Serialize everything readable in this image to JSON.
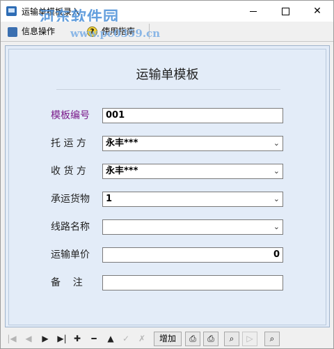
{
  "window": {
    "title": "运输单模板录入",
    "watermark_logo": "河东软件园",
    "watermark_url": "www.pc0359.cn"
  },
  "menubar": {
    "items": [
      {
        "label": "信息操作",
        "icon": "save-icon"
      },
      {
        "label": "使用指南",
        "icon": "help-icon"
      }
    ]
  },
  "form": {
    "title": "运输单模板",
    "fields": [
      {
        "label": "模板编号",
        "value": "001",
        "type": "text"
      },
      {
        "label": "托 运 方",
        "value": "永丰***",
        "type": "dropdown"
      },
      {
        "label": "收 货 方",
        "value": "永丰***",
        "type": "dropdown"
      },
      {
        "label": "承运货物",
        "value": "1",
        "type": "dropdown"
      },
      {
        "label": "线路名称",
        "value": "",
        "type": "dropdown"
      },
      {
        "label": "运输单价",
        "value": "0",
        "type": "number"
      },
      {
        "label": "备    注",
        "value": "",
        "type": "text"
      }
    ]
  },
  "navbar": {
    "add_label": "增加",
    "glyphs": {
      "first": "|◀",
      "prev": "◀",
      "next": "▶",
      "last": "▶|",
      "insert": "✚",
      "delete": "━",
      "up": "▲",
      "post": "✓",
      "cancel": "✗",
      "play": "▷"
    }
  }
}
